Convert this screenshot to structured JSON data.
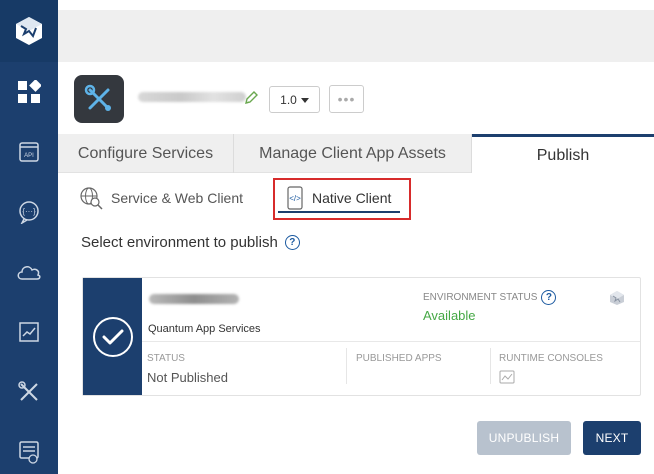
{
  "header": {
    "version": "1.0",
    "more": "•••"
  },
  "tabs": [
    {
      "label": "Configure Services"
    },
    {
      "label": "Manage Client App Assets"
    },
    {
      "label": "Publish"
    }
  ],
  "subtabs": [
    {
      "label": "Service & Web Client"
    },
    {
      "label": "Native Client"
    }
  ],
  "environment": {
    "heading": "Select environment to publish",
    "help": "?",
    "card": {
      "type": "Quantum App Services",
      "status_header": "ENVIRONMENT STATUS",
      "status_value": "Available",
      "col_status": "STATUS",
      "col_published_apps": "PUBLISHED APPS",
      "col_runtime": "RUNTIME CONSOLES",
      "status_text": "Not Published"
    }
  },
  "buttons": {
    "unpublish": "UNPUBLISH",
    "next": "NEXT"
  },
  "colors": {
    "nav": "#1c3f6e",
    "available": "#45a845",
    "highlight": "#d72b2b",
    "disabled_button": "#b8c2ce"
  },
  "icons": {
    "rail": [
      "logo-cube-icon",
      "dashboard-icon",
      "api-icon",
      "message-icon",
      "cloud-icon",
      "analytics-icon",
      "tools-icon",
      "marketplace-icon"
    ]
  }
}
